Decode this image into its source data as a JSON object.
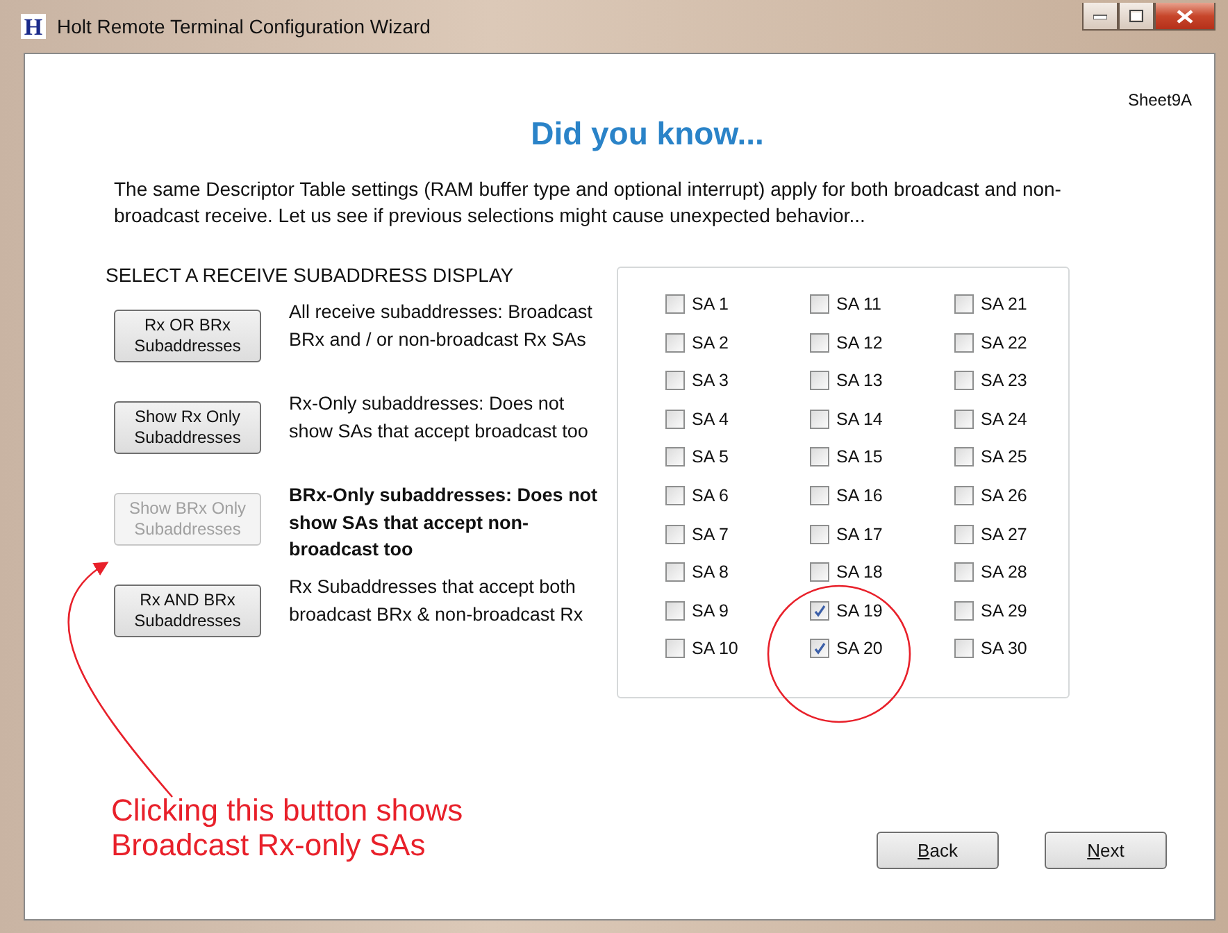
{
  "window": {
    "title": "Holt Remote Terminal Configuration Wizard",
    "app_icon_letter": "H"
  },
  "sheet_label": "Sheet9A",
  "heading": "Did you know...",
  "intro": "The  same Descriptor Table settings (RAM buffer type and optional interrupt) apply for both broadcast and non-broadcast receive. Let us see if previous selections might cause unexpected  behavior...",
  "display_section": {
    "title": "SELECT A RECEIVE SUBADDRESS DISPLAY",
    "options": [
      {
        "button": [
          "Rx OR BRx",
          "Subaddresses"
        ],
        "disabled": false,
        "emphasized": false,
        "description": "All receive subaddresses: Broadcast BRx and / or non-broadcast Rx SAs"
      },
      {
        "button": [
          "Show Rx Only",
          "Subaddresses"
        ],
        "disabled": false,
        "emphasized": false,
        "description": "Rx-Only subaddresses: Does not show SAs that accept broadcast too"
      },
      {
        "button": [
          "Show BRx Only",
          "Subaddresses"
        ],
        "disabled": true,
        "emphasized": true,
        "description": "BRx-Only subaddresses: Does not show SAs that accept non-broadcast too"
      },
      {
        "button": [
          "Rx AND BRx",
          "Subaddresses"
        ],
        "disabled": false,
        "emphasized": false,
        "description": "Rx Subaddresses that accept both broadcast BRx & non-broadcast Rx"
      }
    ]
  },
  "subaddresses": [
    {
      "label": "SA 1",
      "checked": false
    },
    {
      "label": "SA 2",
      "checked": false
    },
    {
      "label": "SA 3",
      "checked": false
    },
    {
      "label": "SA 4",
      "checked": false
    },
    {
      "label": "SA 5",
      "checked": false
    },
    {
      "label": "SA 6",
      "checked": false
    },
    {
      "label": "SA 7",
      "checked": false
    },
    {
      "label": "SA 8",
      "checked": false
    },
    {
      "label": "SA 9",
      "checked": false
    },
    {
      "label": "SA 10",
      "checked": false
    },
    {
      "label": "SA 11",
      "checked": false
    },
    {
      "label": "SA 12",
      "checked": false
    },
    {
      "label": "SA 13",
      "checked": false
    },
    {
      "label": "SA 14",
      "checked": false
    },
    {
      "label": "SA 15",
      "checked": false
    },
    {
      "label": "SA 16",
      "checked": false
    },
    {
      "label": "SA 17",
      "checked": false
    },
    {
      "label": "SA 18",
      "checked": false
    },
    {
      "label": "SA 19",
      "checked": true
    },
    {
      "label": "SA 20",
      "checked": true
    },
    {
      "label": "SA 21",
      "checked": false
    },
    {
      "label": "SA 22",
      "checked": false
    },
    {
      "label": "SA 23",
      "checked": false
    },
    {
      "label": "SA 24",
      "checked": false
    },
    {
      "label": "SA 25",
      "checked": false
    },
    {
      "label": "SA 26",
      "checked": false
    },
    {
      "label": "SA 27",
      "checked": false
    },
    {
      "label": "SA 28",
      "checked": false
    },
    {
      "label": "SA 29",
      "checked": false
    },
    {
      "label": "SA 30",
      "checked": false
    }
  ],
  "annotation": {
    "text": [
      "Clicking this button shows",
      "Broadcast Rx-only SAs"
    ]
  },
  "nav_buttons": [
    {
      "label": "Back",
      "underline_first": true
    },
    {
      "label": "Next",
      "underline_first": true
    }
  ]
}
